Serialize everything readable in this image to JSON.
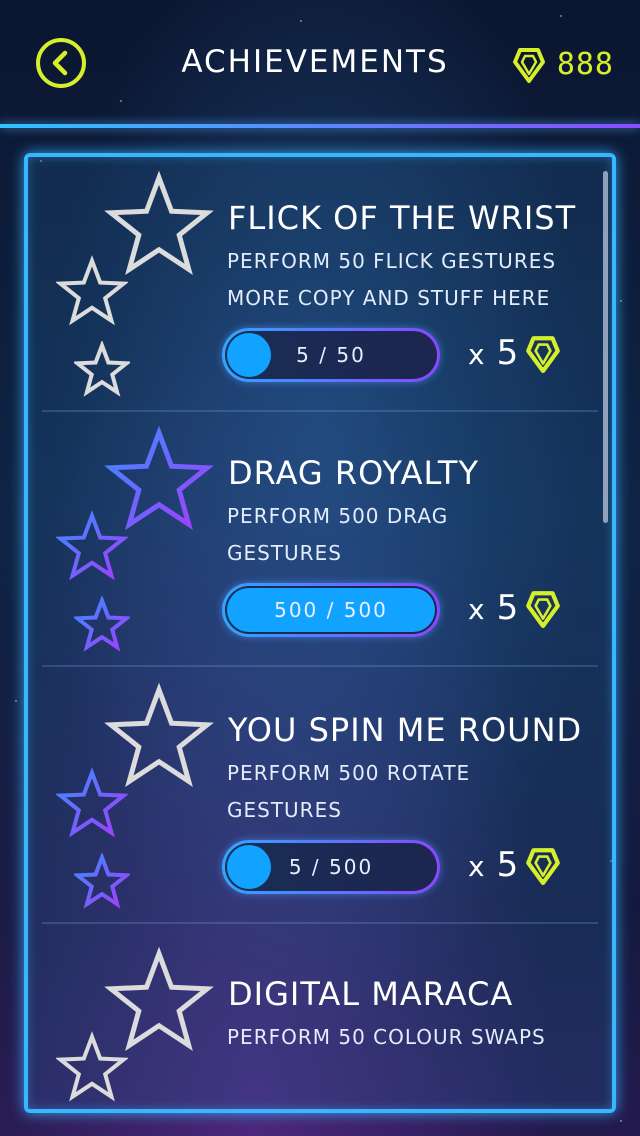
{
  "header": {
    "title": "ACHIEVEMENTS",
    "gem_count": "888"
  },
  "colors": {
    "accent_yellow": "#d7ef2a",
    "accent_blue": "#38b6ff",
    "accent_purple": "#8a46ff",
    "star_white": "#dcdcdc"
  },
  "icons": {
    "back": "chevron-left-icon",
    "gem": "gem-icon",
    "star": "star-icon"
  },
  "achievements": [
    {
      "title": "FLICK OF THE WRIST",
      "desc_line1": "PERFORM 50 FLICK GESTURES",
      "desc_line2": "MORE COPY AND STUFF HERE",
      "progress_text": "5 / 50",
      "progress": 0.1,
      "reward_x": "x",
      "reward_amount": "5",
      "stars_earned": 0
    },
    {
      "title": "DRAG ROYALTY",
      "desc_line1": "PERFORM 500 DRAG",
      "desc_line2": "GESTURES",
      "progress_text": "500 / 500",
      "progress": 1.0,
      "reward_x": "x",
      "reward_amount": "5",
      "stars_earned": 3
    },
    {
      "title": "YOU SPIN ME ROUND",
      "desc_line1": "PERFORM 500 ROTATE",
      "desc_line2": "GESTURES",
      "progress_text": "5 / 500",
      "progress": 0.01,
      "reward_x": "x",
      "reward_amount": "5",
      "stars_earned": 2
    },
    {
      "title": "DIGITAL MARACA",
      "desc_line1": "PERFORM 50 COLOUR SWAPS",
      "desc_line2": "",
      "stars_earned": 0
    }
  ]
}
